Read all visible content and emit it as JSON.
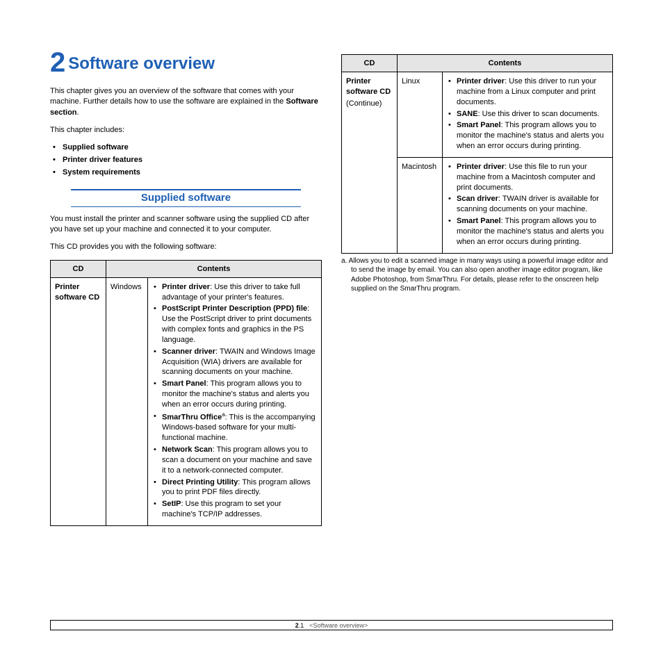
{
  "chapter": {
    "number": "2",
    "title": "Software overview"
  },
  "intro": {
    "p1a": "This chapter gives you an overview of the software that comes with your machine. Further details how to use the software are explained in the ",
    "p1b": "Software section",
    "p1c": ".",
    "p2": "This chapter includes:",
    "toc": [
      "Supplied software",
      "Printer driver features",
      "System requirements"
    ]
  },
  "section1": {
    "heading": "Supplied software",
    "p1": "You must install the printer and scanner software using the supplied CD after you have set up your machine and connected it to your computer.",
    "p2": "This CD provides you with the following software:"
  },
  "tableHeaders": {
    "cd": "CD",
    "contents": "Contents"
  },
  "leftTable": {
    "label": "Printer software CD",
    "os": "Windows",
    "items": [
      {
        "b": "Printer driver",
        "t": ": Use this driver to take full advantage of your printer's features."
      },
      {
        "b": "PostScript Printer Description (PPD) file",
        "t": ": Use the PostScript driver to print documents with complex fonts and graphics in the PS language."
      },
      {
        "b": "Scanner driver",
        "t": ": TWAIN and Windows Image Acquisition (WIA) drivers are available for scanning documents on your machine."
      },
      {
        "b": "Smart Panel",
        "t": ": This program allows you to monitor the machine's status and alerts you when an error occurs during printing."
      },
      {
        "b": "SmarThru Office",
        "sup": "a",
        "t": ": This is the accompanying Windows-based software for your multi-functional machine."
      },
      {
        "b": "Network Scan",
        "t": ": This program allows you to scan a document on your machine and save it to a network-connected computer."
      },
      {
        "b": "Direct Printing Utility",
        "t": ": This program allows you to print PDF files directly."
      },
      {
        "b": "SetIP",
        "t": ": Use this program to set your machine's TCP/IP addresses."
      }
    ]
  },
  "rightTable": {
    "label": "Printer software CD",
    "labelSub": "(Continue)",
    "rows": [
      {
        "os": "Linux",
        "items": [
          {
            "b": "Printer driver",
            "t": ": Use this driver to run your machine from a Linux computer and print documents."
          },
          {
            "b": "SANE",
            "t": ": Use this driver to scan documents."
          },
          {
            "b": "Smart Panel",
            "t": ": This program allows you to monitor the machine's status and alerts you when an error occurs during printing."
          }
        ]
      },
      {
        "os": "Macintosh",
        "items": [
          {
            "b": "Printer driver",
            "t": ": Use this file to run your machine from a Macintosh computer and print documents."
          },
          {
            "b": "Scan driver",
            "t": ": TWAIN driver is available for scanning documents on your machine."
          },
          {
            "b": "Smart Panel",
            "t": ": This program allows you to monitor the machine's status and alerts you when an error occurs during printing."
          }
        ]
      }
    ]
  },
  "footnote": {
    "marker": "a.",
    "text": "Allows you to edit a scanned image in many ways using a powerful image editor and to send the image by email. You can also open another image editor program, like Adobe Photoshop, from SmarThru. For details, please refer to the onscreen help supplied on the SmarThru program."
  },
  "footer": {
    "pageBold": "2",
    "pageRest": ".1",
    "breadcrumb": "<Software overview>"
  }
}
